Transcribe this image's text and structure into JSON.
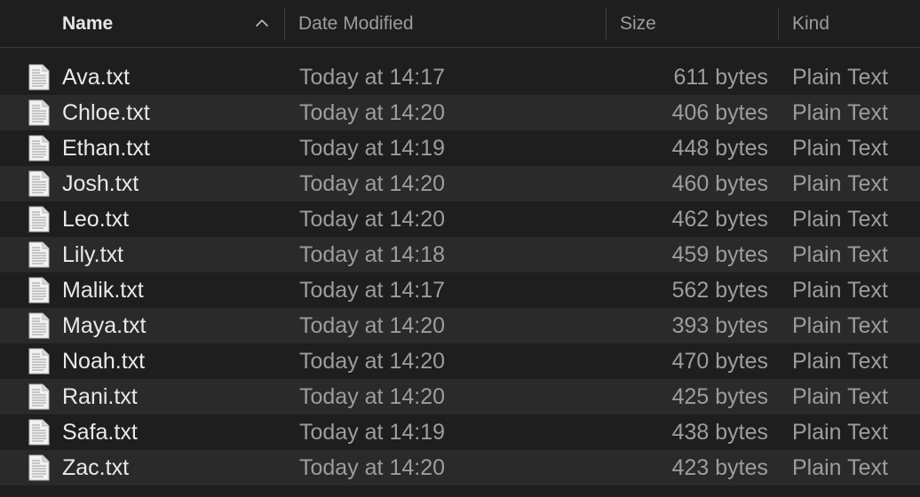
{
  "header": {
    "name_label": "Name",
    "date_label": "Date Modified",
    "size_label": "Size",
    "kind_label": "Kind",
    "sort_icon": "chevron-up-icon"
  },
  "file_icon": "text-document-icon",
  "files": [
    {
      "name": "Ava.txt",
      "date": "Today at 14:17",
      "size": "611 bytes",
      "kind": "Plain Text"
    },
    {
      "name": "Chloe.txt",
      "date": "Today at 14:20",
      "size": "406 bytes",
      "kind": "Plain Text"
    },
    {
      "name": "Ethan.txt",
      "date": "Today at 14:19",
      "size": "448 bytes",
      "kind": "Plain Text"
    },
    {
      "name": "Josh.txt",
      "date": "Today at 14:20",
      "size": "460 bytes",
      "kind": "Plain Text"
    },
    {
      "name": "Leo.txt",
      "date": "Today at 14:20",
      "size": "462 bytes",
      "kind": "Plain Text"
    },
    {
      "name": "Lily.txt",
      "date": "Today at 14:18",
      "size": "459 bytes",
      "kind": "Plain Text"
    },
    {
      "name": "Malik.txt",
      "date": "Today at 14:17",
      "size": "562 bytes",
      "kind": "Plain Text"
    },
    {
      "name": "Maya.txt",
      "date": "Today at 14:20",
      "size": "393 bytes",
      "kind": "Plain Text"
    },
    {
      "name": "Noah.txt",
      "date": "Today at 14:20",
      "size": "470 bytes",
      "kind": "Plain Text"
    },
    {
      "name": "Rani.txt",
      "date": "Today at 14:20",
      "size": "425 bytes",
      "kind": "Plain Text"
    },
    {
      "name": "Safa.txt",
      "date": "Today at 14:19",
      "size": "438 bytes",
      "kind": "Plain Text"
    },
    {
      "name": "Zac.txt",
      "date": "Today at 14:20",
      "size": "423 bytes",
      "kind": "Plain Text"
    }
  ]
}
